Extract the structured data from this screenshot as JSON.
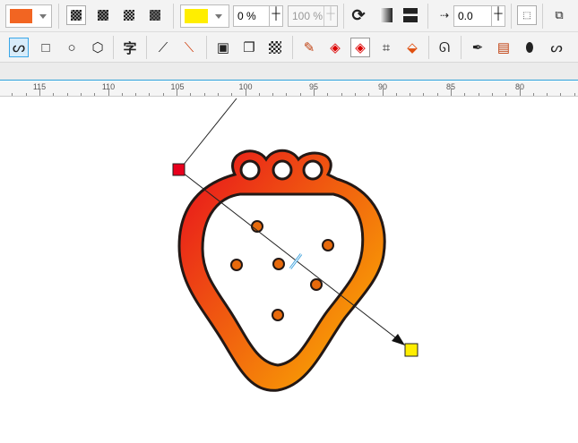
{
  "toolbar_top": {
    "fill_color": "#f26522",
    "transparency_modes": [
      "uniform-checker-icon",
      "fountain-checker-icon",
      "pattern-checker-icon",
      "texture-checker-icon"
    ],
    "end_color": "#ffee00",
    "opacity_start": "0 %",
    "opacity_end": "100 %",
    "offset_value": "0.0"
  },
  "toolbar_tools": {
    "glyph_text": "字"
  },
  "ruler": {
    "labels": [
      "115",
      "110",
      "105",
      "100",
      "95",
      "90",
      "85",
      "80"
    ]
  },
  "drawing": {
    "gradient_start_color": "#e8141c",
    "gradient_end_color": "#fbb800",
    "handle_start_color": "#e8001c",
    "handle_end_color": "#ffee00",
    "seed_color": "#e86a0c"
  }
}
